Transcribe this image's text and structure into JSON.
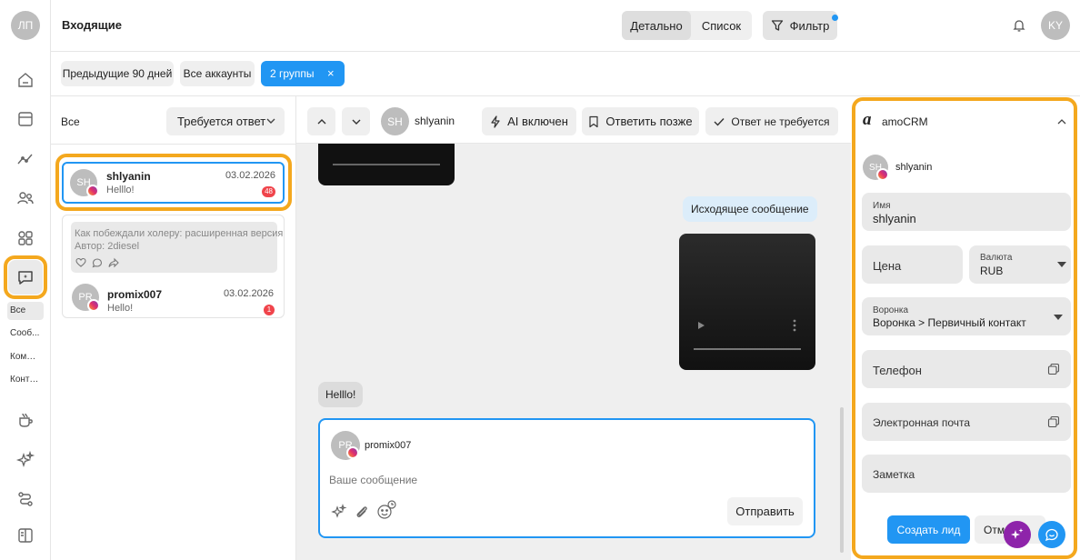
{
  "rail": {
    "user_initials": "ЛП",
    "icons": [
      "home-icon",
      "calendar-icon",
      "analytics-icon",
      "users-icon",
      "apps-icon",
      "inbox-icon",
      "coffee-icon",
      "sparkle-icon",
      "flow-icon",
      "book-icon"
    ],
    "sub_items": [
      "Все",
      "Сооб...",
      "Комме...",
      "Конта..."
    ]
  },
  "header": {
    "title": "Входящие",
    "view_detail": "Детально",
    "view_list": "Список",
    "filter": "Фильтр",
    "user_initials": "KY"
  },
  "filters": {
    "period": "Предыдущие 90 дней",
    "accounts": "Все аккаунты",
    "groups": "2 группы",
    "close": "×"
  },
  "list": {
    "all_label": "Все",
    "status_dropdown": "Требуется ответ",
    "conversations": [
      {
        "initials": "SH",
        "name": "shlyanin",
        "date": "03.02.2026",
        "preview": "Helllo!",
        "badge": "48"
      },
      {
        "initials": "PR",
        "name": "promix007",
        "date": "03.02.2026",
        "preview": "Hello!",
        "badge": "1",
        "quote_title": "Как побеждали холеру: расширенная версия",
        "quote_author": "Автор: 2diesel"
      }
    ]
  },
  "chat_header": {
    "initials": "SH",
    "username": "shlyanin",
    "ai": "AI включен",
    "later": "Ответить позже",
    "no_reply": "Ответ не требуется"
  },
  "chat": {
    "outgoing": "Исходящее сообщение",
    "incoming": "Helllo!",
    "composer": {
      "initials": "PR",
      "username": "promix007",
      "placeholder": "Ваше сообщение",
      "send": "Отправить"
    }
  },
  "crm": {
    "brand": "amoCRM",
    "contact_initials": "SH",
    "contact_name": "shlyanin",
    "name_label": "Имя",
    "name_value": "shlyanin",
    "price_placeholder": "Цена",
    "currency_label": "Валюта",
    "currency_value": "RUB",
    "pipeline_label": "Воронка",
    "pipeline_value": "Воронка > Первичный контакт",
    "phone": "Телефон",
    "email": "Электронная почта",
    "note": "Заметка",
    "create": "Создать лид",
    "cancel": "Отм"
  },
  "colors": {
    "accent": "#2196f3",
    "highlight": "#f4a81e",
    "badge": "#f0444b",
    "ai_fab": "#8e24aa"
  }
}
